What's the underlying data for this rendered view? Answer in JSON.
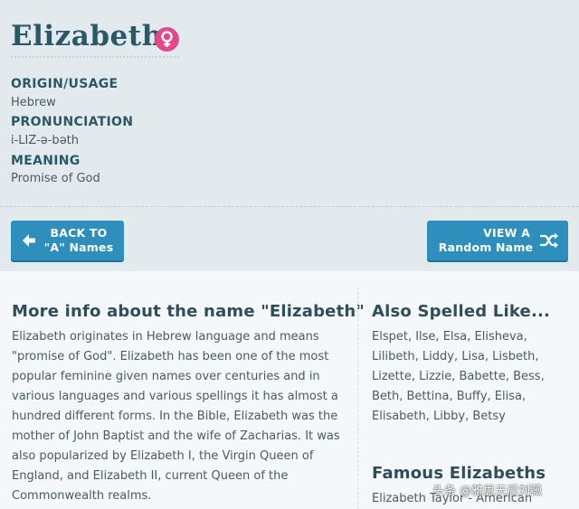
{
  "name": {
    "title": "Elizabeth",
    "gender_icon": "female-symbol-icon",
    "gender_color": "#e4478c"
  },
  "details": {
    "origin_label": "ORIGIN/USAGE",
    "origin_value": "Hebrew",
    "pronunciation_label": "PRONUNCIATION",
    "pronunciation_value": "i-LIZ-ə-bəth",
    "meaning_label": "MEANING",
    "meaning_value": "Promise of God"
  },
  "buttons": {
    "back_line1": "BACK TO",
    "back_line2": "\"A\" Names",
    "back_icon": "arrow-left-icon",
    "random_line1": "VIEW A",
    "random_line2": "Random Name",
    "random_icon": "shuffle-icon",
    "color": "#2e8fbd"
  },
  "more_info": {
    "heading": "More info about the name \"Elizabeth\"",
    "lines": [
      "Elizabeth originates in Hebrew language and means",
      "\"promise of God\". Elizabeth has been one of the most",
      "popular feminine given names over centuries and in",
      "various languages and various spellings it has almost a",
      "hundred different forms. In the Bible, Elizabeth was the",
      "mother of John Baptist and the wife of Zacharias. It was",
      "also popularized by Elizabeth I, the Virgin Queen of",
      "England, and Elizabeth II, current Queen of the",
      "Commonwealth realms."
    ]
  },
  "also_spelled": {
    "heading": "Also Spelled Like...",
    "lines": [
      "Elspet, Ilse, Elsa, Elisheva,",
      "Lilibeth, Liddy, Lisa, Lisbeth,",
      "Lizette, Lizzie, Babette, Bess,",
      "Beth, Bettina, Buffy, Elisa,",
      "Elisabeth, Libby, Betsy"
    ]
  },
  "famous": {
    "heading": "Famous Elizabeths",
    "first_item": "Elizabeth Taylor - American"
  },
  "watermark": "头条 @雅思天后刘薇"
}
